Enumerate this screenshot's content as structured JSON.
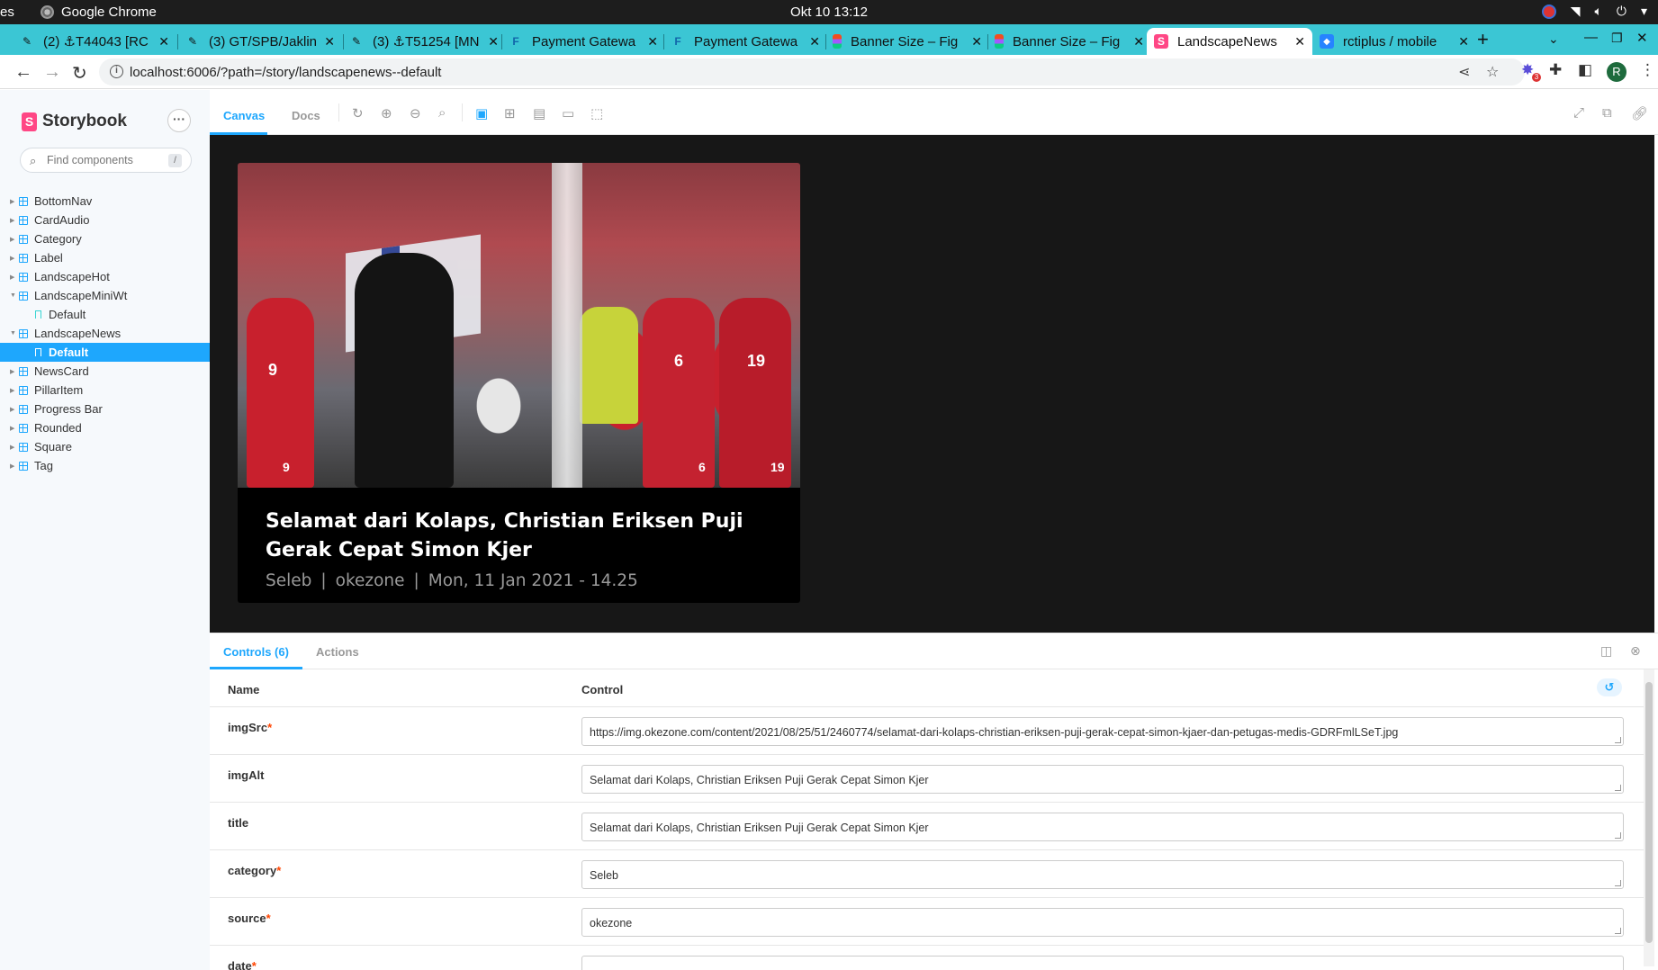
{
  "os": {
    "activities": "es",
    "app_name": "Google Chrome",
    "clock": "Okt 10  13:12"
  },
  "browser": {
    "tabs": [
      {
        "title": "(2) ⚓T44043 [RC",
        "favicon": "phabricator-icon"
      },
      {
        "title": "(3) GT/SPB/Jaklin",
        "favicon": "phabricator-icon"
      },
      {
        "title": "(3) ⚓T51254 [MN",
        "favicon": "phabricator-icon"
      },
      {
        "title": "Payment Gatewa",
        "favicon": "f-icon"
      },
      {
        "title": "Payment Gatewa",
        "favicon": "f-icon"
      },
      {
        "title": "Banner Size – Fig",
        "favicon": "figma-icon"
      },
      {
        "title": "Banner Size – Fig",
        "favicon": "figma-icon"
      },
      {
        "title": "LandscapeNews",
        "favicon": "storybook-icon",
        "active": true
      },
      {
        "title": "rctiplus / mobile",
        "favicon": "bitbucket-icon"
      }
    ],
    "url": "localhost:6006/?path=/story/landscapenews--default",
    "profile_initial": "R",
    "extension_badge": "3"
  },
  "storybook": {
    "brand": "Storybook",
    "search_placeholder": "Find components",
    "search_shortcut": "/",
    "tree": [
      {
        "label": "BottomNav",
        "type": "component"
      },
      {
        "label": "CardAudio",
        "type": "component"
      },
      {
        "label": "Category",
        "type": "component"
      },
      {
        "label": "Label",
        "type": "component"
      },
      {
        "label": "LandscapeHot",
        "type": "component"
      },
      {
        "label": "LandscapeMiniWt",
        "type": "component",
        "expanded": true
      },
      {
        "label": "Default",
        "type": "story"
      },
      {
        "label": "LandscapeNews",
        "type": "component",
        "expanded": true
      },
      {
        "label": "Default",
        "type": "story",
        "selected": true
      },
      {
        "label": "NewsCard",
        "type": "component"
      },
      {
        "label": "PillarItem",
        "type": "component"
      },
      {
        "label": "Progress Bar",
        "type": "component"
      },
      {
        "label": "Rounded",
        "type": "component"
      },
      {
        "label": "Square",
        "type": "component"
      },
      {
        "label": "Tag",
        "type": "component"
      }
    ],
    "toolbar": {
      "tab_canvas": "Canvas",
      "tab_docs": "Docs"
    },
    "preview": {
      "title": "Selamat dari Kolaps, Christian Eriksen Puji Gerak Cepat Simon Kjer",
      "category": "Seleb",
      "source": "okezone",
      "date": "Mon, 11 Jan 2021 - 14.25",
      "separator": "|",
      "photo_numbers": [
        "9",
        "9",
        "6",
        "19",
        "6",
        "19"
      ]
    },
    "addons": {
      "tab_controls": "Controls (6)",
      "tab_actions": "Actions",
      "col_name": "Name",
      "col_control": "Control",
      "rows": [
        {
          "name": "imgSrc",
          "required": true,
          "value": "https://img.okezone.com/content/2021/08/25/51/2460774/selamat-dari-kolaps-christian-eriksen-puji-gerak-cepat-simon-kjaer-dan-petugas-medis-GDRFmlLSeT.jpg"
        },
        {
          "name": "imgAlt",
          "required": false,
          "value": "Selamat dari Kolaps, Christian Eriksen Puji Gerak Cepat Simon Kjer"
        },
        {
          "name": "title",
          "required": false,
          "value": "Selamat dari Kolaps, Christian Eriksen Puji Gerak Cepat Simon Kjer"
        },
        {
          "name": "category",
          "required": true,
          "value": "Seleb"
        },
        {
          "name": "source",
          "required": true,
          "value": "okezone"
        },
        {
          "name": "date",
          "required": true,
          "value": ""
        }
      ]
    }
  }
}
